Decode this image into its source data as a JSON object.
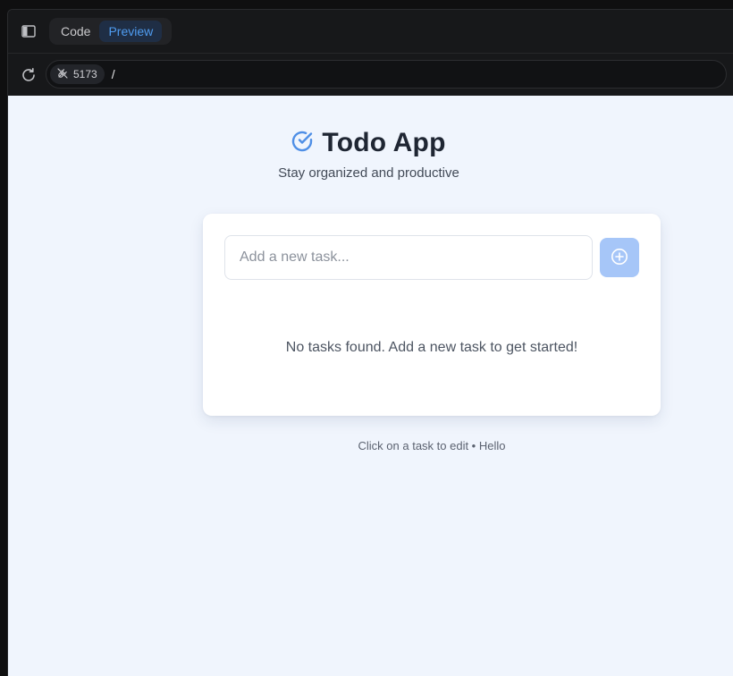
{
  "toolbar": {
    "tabs": [
      {
        "label": "Code",
        "active": false
      },
      {
        "label": "Preview",
        "active": true
      }
    ]
  },
  "address": {
    "port": "5173",
    "path": "/"
  },
  "app": {
    "title": "Todo App",
    "subtitle": "Stay organized and productive",
    "input_placeholder": "Add a new task...",
    "empty_message": "No tasks found. Add a new task to get started!",
    "footer": "Click on a task to edit • Hello"
  },
  "colors": {
    "accent": "#4f8fe6",
    "add_button": "#a6c6f8",
    "viewport_bg": "#f0f5fd",
    "title": "#1f2633"
  },
  "icons": {
    "sidebar": "sidebar-toggle-icon",
    "reload": "reload-icon",
    "port": "plug-icon",
    "title": "check-circle-icon",
    "add": "plus-circle-icon"
  }
}
